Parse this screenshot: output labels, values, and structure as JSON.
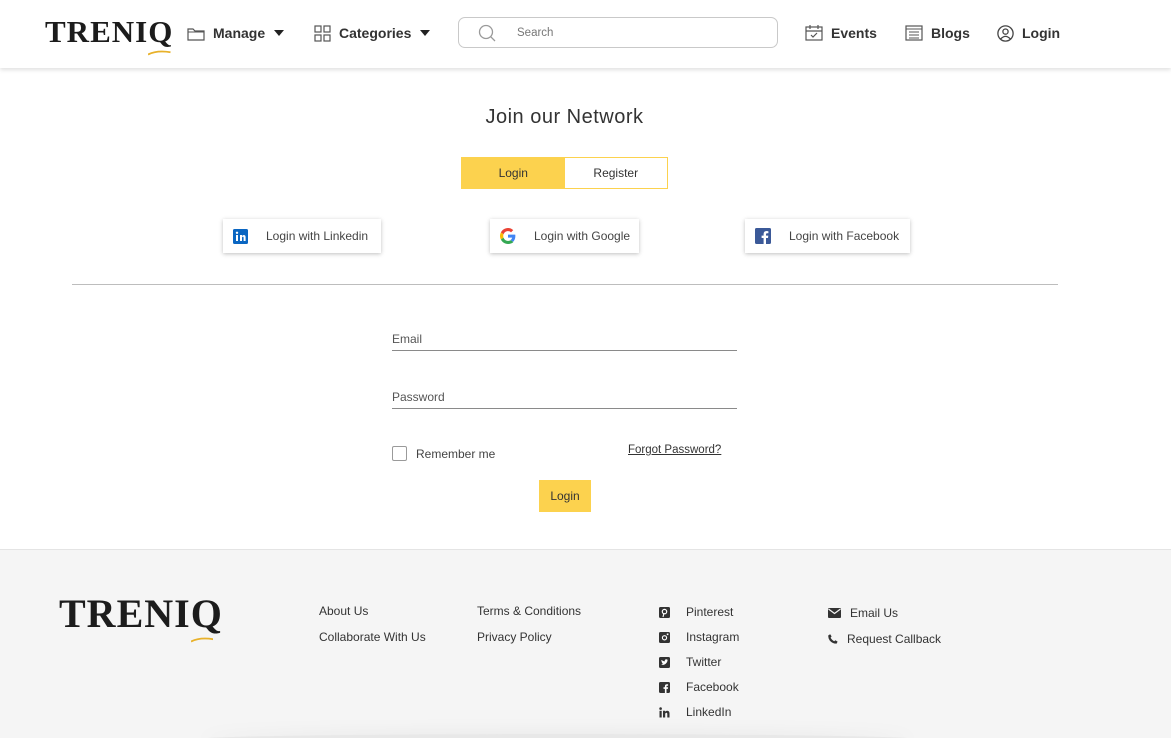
{
  "brand": {
    "name_main": "TRENI",
    "name_q": "Q",
    "accent_color": "#fcd24e"
  },
  "header": {
    "nav": {
      "manage": {
        "label": "Manage",
        "icon": "folder-icon"
      },
      "categories": {
        "label": "Categories",
        "icon": "grid-icon"
      },
      "events": {
        "label": "Events",
        "icon": "calendar-icon"
      },
      "blogs": {
        "label": "Blogs",
        "icon": "newspaper-icon"
      },
      "login": {
        "label": "Login",
        "icon": "user-circle-icon"
      }
    },
    "search": {
      "placeholder": "Search",
      "value": ""
    }
  },
  "main": {
    "title": "Join our Network",
    "tabs": {
      "login": "Login",
      "register": "Register",
      "active": "login"
    },
    "social": {
      "linkedin": "Login with Linkedin",
      "google": "Login with Google",
      "facebook": "Login with Facebook"
    },
    "form": {
      "email_placeholder": "Email",
      "password_placeholder": "Password",
      "remember_label": "Remember me",
      "forgot_label": "Forgot Password?",
      "submit_label": "Login"
    }
  },
  "footer": {
    "col1": {
      "about": "About Us",
      "collaborate": "Collaborate With Us"
    },
    "col2": {
      "terms": "Terms & Conditions",
      "privacy": "Privacy Policy"
    },
    "social": {
      "pinterest": "Pinterest",
      "instagram": "Instagram",
      "twitter": "Twitter",
      "facebook": "Facebook",
      "linkedin": "LinkedIn"
    },
    "contact": {
      "email": "Email Us",
      "callback": "Request Callback"
    }
  }
}
